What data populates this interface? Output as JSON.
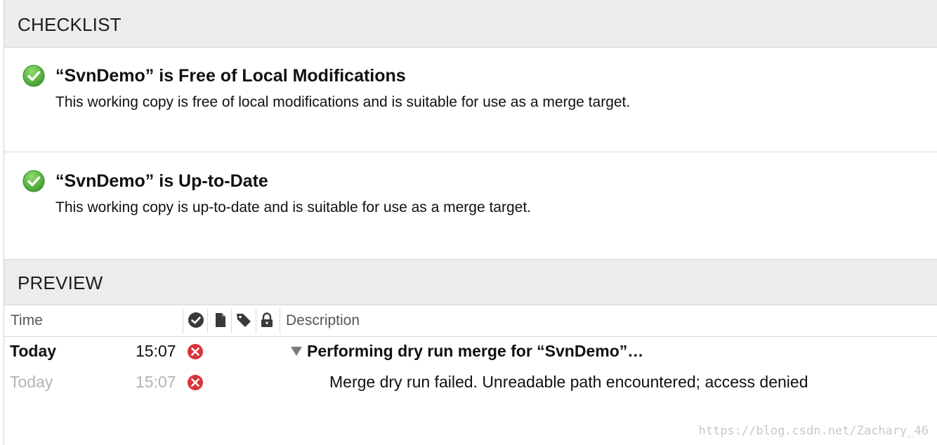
{
  "checklist": {
    "header": "CHECKLIST",
    "items": [
      {
        "title": "“SvnDemo” is Free of Local Modifications",
        "description": "This working copy is free of local modifications and is suitable for use as a merge target.",
        "status_icon": "green-check-circle"
      },
      {
        "title": "“SvnDemo” is Up-to-Date",
        "description": "This working copy is up-to-date and is suitable for use as a merge target.",
        "status_icon": "green-check-circle"
      }
    ]
  },
  "preview": {
    "header": "PREVIEW",
    "columns": {
      "time": "Time",
      "status_icon": "check-circle-icon",
      "file_icon": "document-icon",
      "tag_icon": "tag-icon",
      "lock_icon": "lock-icon",
      "description": "Description"
    },
    "rows": [
      {
        "date": "Today",
        "time": "15:07",
        "status": "error",
        "description": "Performing dry run merge for “SvnDemo”…",
        "expanded": true
      },
      {
        "date": "Today",
        "time": "15:07",
        "status": "error",
        "description": "Merge dry run failed. Unreadable path encountered; access denied"
      }
    ]
  },
  "colors": {
    "success": "#4cae3a",
    "error": "#d9343a",
    "header_bg": "#ececec"
  },
  "watermark": "https://blog.csdn.net/Zachary_46"
}
